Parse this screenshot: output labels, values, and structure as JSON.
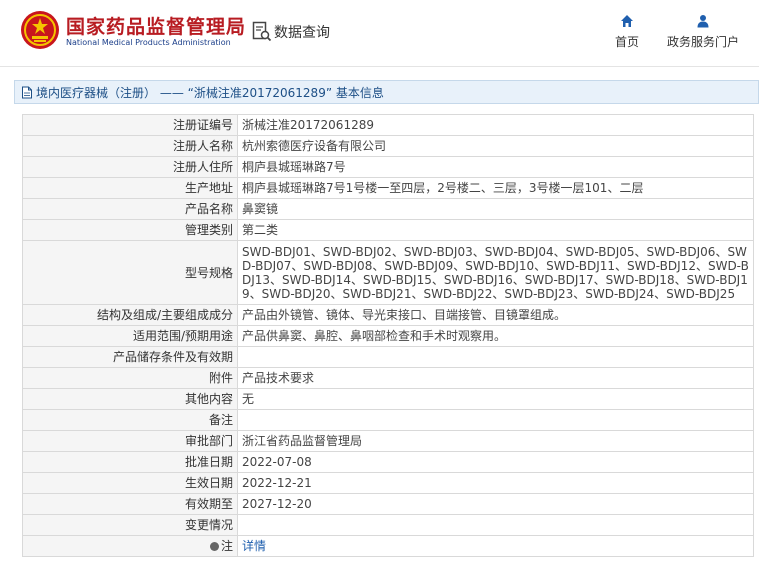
{
  "header": {
    "brand_cn": "国家药品监督管理局",
    "brand_en": "National Medical Products Administration",
    "search_label": "数据查询",
    "nav": {
      "home": "首页",
      "gov_service": "政务服务门户"
    }
  },
  "panel": {
    "title": "境内医疗器械（注册） —— “浙械注准20172061289” 基本信息"
  },
  "rows": [
    {
      "label": "注册证编号",
      "value": "浙械注准20172061289"
    },
    {
      "label": "注册人名称",
      "value": "杭州索德医疗设备有限公司"
    },
    {
      "label": "注册人住所",
      "value": "桐庐县城瑶琳路7号"
    },
    {
      "label": "生产地址",
      "value": "桐庐县城瑶琳路7号1号楼一至四层，2号楼二、三层，3号楼一层101、二层"
    },
    {
      "label": "产品名称",
      "value": "鼻窦镜"
    },
    {
      "label": "管理类别",
      "value": "第二类"
    },
    {
      "label": "型号规格",
      "value": "SWD-BDJ01、SWD-BDJ02、SWD-BDJ03、SWD-BDJ04、SWD-BDJ05、SWD-BDJ06、SWD-BDJ07、SWD-BDJ08、SWD-BDJ09、SWD-BDJ10、SWD-BDJ11、SWD-BDJ12、SWD-BDJ13、SWD-BDJ14、SWD-BDJ15、SWD-BDJ16、SWD-BDJ17、SWD-BDJ18、SWD-BDJ19、SWD-BDJ20、SWD-BDJ21、SWD-BDJ22、SWD-BDJ23、SWD-BDJ24、SWD-BDJ25"
    },
    {
      "label": "结构及组成/主要组成成分",
      "value": "产品由外镜管、镜体、导光束接口、目端接管、目镜罩组成。"
    },
    {
      "label": "适用范围/预期用途",
      "value": "产品供鼻窦、鼻腔、鼻咽部检查和手术时观察用。"
    },
    {
      "label": "产品储存条件及有效期",
      "value": ""
    },
    {
      "label": "附件",
      "value": "产品技术要求"
    },
    {
      "label": "其他内容",
      "value": "无"
    },
    {
      "label": "备注",
      "value": ""
    },
    {
      "label": "审批部门",
      "value": "浙江省药品监督管理局"
    },
    {
      "label": "批准日期",
      "value": "2022-07-08"
    },
    {
      "label": "生效日期",
      "value": "2022-12-21"
    },
    {
      "label": "有效期至",
      "value": "2027-12-20"
    },
    {
      "label": "变更情况",
      "value": ""
    },
    {
      "label": "注",
      "value": "详情"
    }
  ]
}
